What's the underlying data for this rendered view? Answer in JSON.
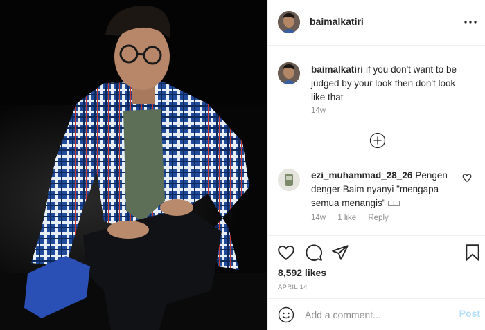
{
  "post": {
    "image_alt": "Post photo",
    "author": "baimalkatiri"
  },
  "header": {
    "username": "baimalkatiri",
    "more_icon": "more-horizontal-icon"
  },
  "caption": {
    "username": "baimalkatiri",
    "text": "if you don't want to be judged by your look then don't look like that",
    "time": "14w"
  },
  "load_more_icon": "plus-circle-icon",
  "comments": [
    {
      "username": "ezi_muhammad_28_26",
      "text": "Pengen denger Baim nyanyi \"mengapa semua menangis\" □□",
      "time": "14w",
      "likes": "1 like",
      "reply": "Reply",
      "like_icon": "heart-outline-icon"
    }
  ],
  "actions": {
    "icons": [
      "heart-outline-icon",
      "comment-bubble-icon",
      "paper-plane-icon",
      "bookmark-icon"
    ],
    "likes": "8,592 likes",
    "date": "APRIL 14"
  },
  "add_comment": {
    "emoji_icon": "smiley-icon",
    "placeholder": "Add a comment...",
    "post_label": "Post",
    "post_color": "#b2dffc"
  },
  "colors": {
    "text": "#262626",
    "muted": "#8e8e8e",
    "divider": "#efefef",
    "photo_bg": "#050505"
  }
}
